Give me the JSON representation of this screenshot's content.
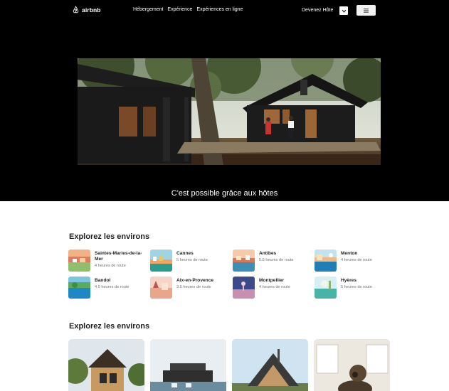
{
  "header": {
    "logo_text": "airbnb",
    "nav": [
      "Hébergement",
      "Expérience",
      "Expériences en ligne"
    ],
    "become_host": "Devenez Hôte",
    "globe_icon": "chevron-down-icon",
    "menu_icon": "hamburger-icon"
  },
  "hero": {
    "caption": "C'est possible grâce aux hôtes"
  },
  "explore": {
    "title": "Explorez les environs",
    "destinations": [
      {
        "name": "Saintes-Maries-de-la-Mer",
        "time": "4 heures de route"
      },
      {
        "name": "Cannes",
        "time": "5 heures de route"
      },
      {
        "name": "Antibes",
        "time": "5.5 heures de route"
      },
      {
        "name": "Menton",
        "time": "4 heures de route"
      },
      {
        "name": "Bandol",
        "time": "4.5 heures de route"
      },
      {
        "name": "Aix-en-Provence",
        "time": "3.5 heures de route"
      },
      {
        "name": "Montpellier",
        "time": "4 heures de route"
      },
      {
        "name": "Hyères",
        "time": "5 heures de route"
      }
    ]
  },
  "explore2": {
    "title": "Explorez les environs"
  },
  "colors": {
    "hero_bg": "#000000",
    "text": "#222222",
    "muted": "#717171"
  }
}
